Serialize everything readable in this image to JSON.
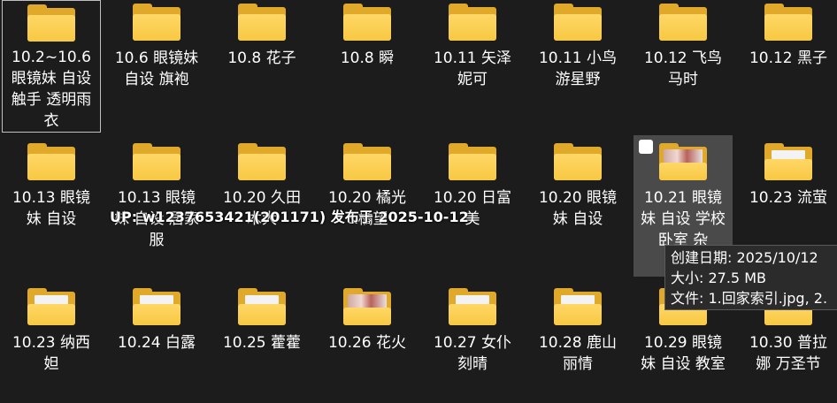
{
  "folders": [
    {
      "label": "10.2~10.6 眼镜妹 自设 触手 透明雨衣",
      "icon": "folder-icon"
    },
    {
      "label": "10.6 眼镜妹 自设 旗袍",
      "icon": "folder-icon"
    },
    {
      "label": "10.8 花子",
      "icon": "folder-icon"
    },
    {
      "label": "10.8 瞬",
      "icon": "folder-icon"
    },
    {
      "label": "10.11 矢泽妮可",
      "icon": "folder-icon"
    },
    {
      "label": "10.11 小鸟游星野",
      "icon": "folder-icon"
    },
    {
      "label": "10.12 飞鸟马时",
      "icon": "folder-icon"
    },
    {
      "label": "10.12 黑子",
      "icon": "folder-icon"
    },
    {
      "label": "10.13 眼镜妹 自设",
      "icon": "folder-icon"
    },
    {
      "label": "10.13 眼镜妹 自设 居家服",
      "icon": "folder-icon"
    },
    {
      "label": "10.20 久田 木大",
      "icon": "folder-icon"
    },
    {
      "label": "10.20 橘光 &橘望",
      "icon": "folder-icon"
    },
    {
      "label": "10.20 日富美",
      "icon": "folder-icon"
    },
    {
      "label": "10.20 眼镜妹 自设",
      "icon": "folder-icon"
    },
    {
      "label": "10.21 眼镜妹 自设 学校 卧室 杂",
      "icon": "folder-thumbnail-icon"
    },
    {
      "label": "10.23 流萤",
      "icon": "folder-with-file-icon"
    },
    {
      "label": "10.23 纳西妲",
      "icon": "folder-with-file-icon"
    },
    {
      "label": "10.24 白露",
      "icon": "folder-with-file-icon"
    },
    {
      "label": "10.25 藿藿",
      "icon": "folder-with-file-icon"
    },
    {
      "label": "10.26 花火",
      "icon": "folder-thumbnail-icon"
    },
    {
      "label": "10.27 女仆 刻晴",
      "icon": "folder-with-file-icon"
    },
    {
      "label": "10.28 鹿山丽情",
      "icon": "folder-with-file-icon"
    },
    {
      "label": "10.29 眼镜妹 自设 教室",
      "icon": "folder-with-file-icon"
    },
    {
      "label": "10.30 普拉娜 万圣节",
      "icon": "folder-with-file-icon"
    }
  ],
  "overlay_text": "UP: w1237653421(201171) 发布于 2025-10-12",
  "tooltip": {
    "created": "创建日期: 2025/10/12",
    "size": "大小: 27.5 MB",
    "files": "文件: 1.回家索引.jpg, 2."
  },
  "colors": {
    "background": "#1c1c1c",
    "folder_front": "#f7c842",
    "folder_back": "#e0a92a",
    "hover": "#4a4a4a"
  }
}
